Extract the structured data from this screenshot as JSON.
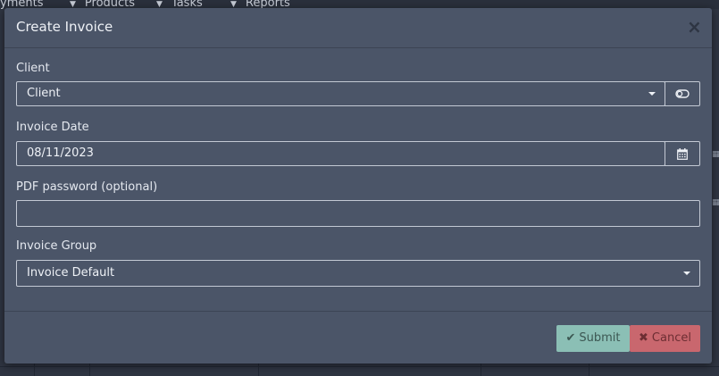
{
  "background": {
    "nav_items": [
      "yments",
      "Products",
      "Tasks",
      "Reports"
    ]
  },
  "modal": {
    "title": "Create Invoice",
    "close_glyph": "×"
  },
  "fields": {
    "client": {
      "label": "Client",
      "value": "Client",
      "addon_icon": "toggle-icon"
    },
    "invoice_date": {
      "label": "Invoice Date",
      "value": "08/11/2023",
      "addon_icon": "calendar-icon"
    },
    "pdf_password": {
      "label": "PDF password (optional)",
      "value": ""
    },
    "invoice_group": {
      "label": "Invoice Group",
      "value": "Invoice Default"
    }
  },
  "footer": {
    "submit_label": "Submit",
    "submit_icon": "✔",
    "cancel_label": "Cancel",
    "cancel_icon": "✖"
  },
  "colors": {
    "modal_bg": "#4b5568",
    "submit": "#8bbfb5",
    "cancel": "#c9676e"
  }
}
